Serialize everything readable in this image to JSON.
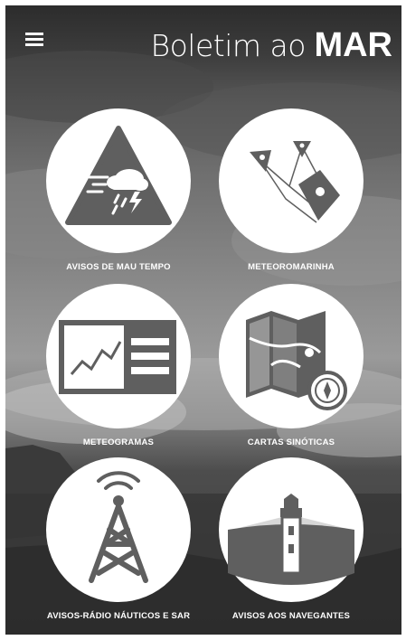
{
  "app": {
    "title_light": "Boletim ao",
    "title_bold": "MAR"
  },
  "menu": {
    "icon": "hamburger-menu-icon"
  },
  "tiles": [
    {
      "label": "AVISOS DE MAU TEMPO",
      "icon": "storm-warning-icon"
    },
    {
      "label": "METEOROMARINHA",
      "icon": "map-pins-icon"
    },
    {
      "label": "METEOGRAMAS",
      "icon": "chart-panel-icon"
    },
    {
      "label": "CARTAS SINÓTICAS",
      "icon": "map-compass-icon"
    },
    {
      "label": "AVISOS-RÁDIO NÁUTICOS E SAR",
      "icon": "radio-tower-icon"
    },
    {
      "label": "AVISOS AOS NAVEGANTES",
      "icon": "lighthouse-icon"
    }
  ],
  "colors": {
    "icon_gray": "#5f5f5f",
    "circle": "#ffffff",
    "text": "#ffffff"
  }
}
